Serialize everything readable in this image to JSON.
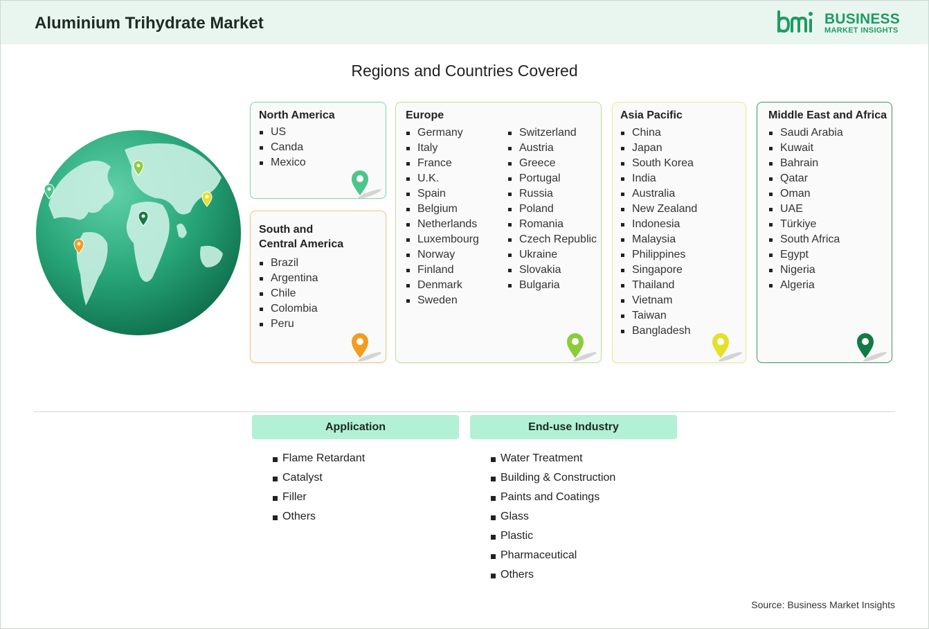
{
  "header": {
    "title": "Aluminium Trihydrate Market",
    "logo_line1": "BUSINESS",
    "logo_line2": "MARKET INSIGHTS",
    "logo_mark": "bmi"
  },
  "subtitle": "Regions and Countries Covered",
  "regions": {
    "north_america": {
      "name": "North America",
      "countries": [
        "US",
        "Canda",
        "Mexico"
      ],
      "color": "#4cc58a"
    },
    "south_america": {
      "name": "South and Central America",
      "name_line1": "South and",
      "name_line2": "Central America",
      "countries": [
        "Brazil",
        "Argentina",
        "Chile",
        "Colombia",
        "Peru"
      ],
      "color": "#f39c1f"
    },
    "europe": {
      "name": "Europe",
      "countries_col1": [
        "Germany",
        "Italy",
        "France",
        "U.K.",
        "Spain",
        "Belgium",
        "Netherlands",
        "Luxembourg",
        "Norway",
        "Finland",
        "Denmark",
        "Sweden"
      ],
      "countries_col2": [
        "Switzerland",
        "Austria",
        "Greece",
        "Portugal",
        "Russia",
        "Poland",
        "Romania",
        "Czech Republic",
        "Ukraine",
        "Slovakia",
        "Bulgaria"
      ],
      "color": "#8ccc3a"
    },
    "asia_pacific": {
      "name": "Asia Pacific",
      "countries": [
        "China",
        "Japan",
        "South Korea",
        "India",
        "Australia",
        "New Zealand",
        "Indonesia",
        "Malaysia",
        "Philippines",
        "Singapore",
        "Thailand",
        "Vietnam",
        "Taiwan",
        "Bangladesh"
      ],
      "color": "#e4e12a"
    },
    "mea": {
      "name": "Middle East and Africa",
      "countries": [
        "Saudi Arabia",
        "Kuwait",
        "Bahrain",
        "Qatar",
        "Oman",
        "UAE",
        "Türkiye",
        "South Africa",
        "Egypt",
        "Nigeria",
        "Algeria"
      ],
      "color": "#147a45"
    }
  },
  "segments": {
    "application": {
      "label": "Application",
      "items": [
        "Flame Retardant",
        "Catalyst",
        "Filler",
        "Others"
      ]
    },
    "end_use": {
      "label": "End-use Industry",
      "items": [
        "Water Treatment",
        "Building & Construction",
        "Paints and Coatings",
        "Glass",
        "Plastic",
        "Pharmaceutical",
        "Others"
      ]
    }
  },
  "source": "Source: Business Market Insights",
  "colors": {
    "header_bg": "#e9f6ef",
    "segment_header_bg": "#b2f1d5",
    "brand_green": "#1e9b62"
  }
}
